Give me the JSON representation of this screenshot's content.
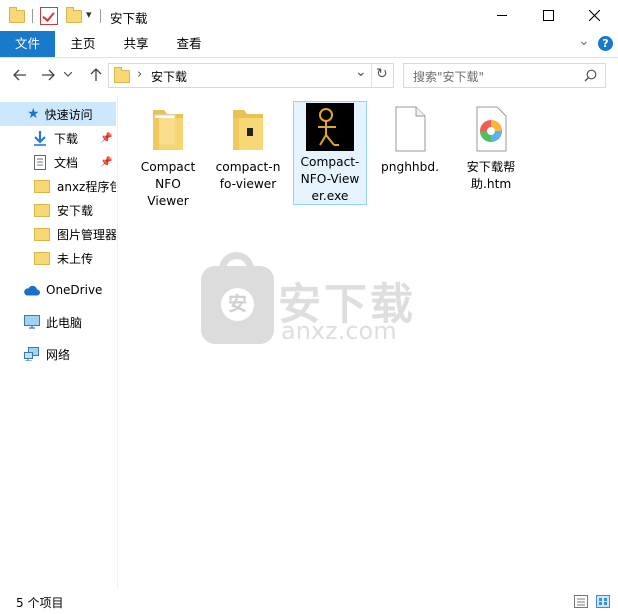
{
  "window": {
    "title": "安下载"
  },
  "quick_access_toolbar": {
    "dropdown_glyph": "▾"
  },
  "window_controls": {
    "minimize": "—",
    "maximize": "☐",
    "close": "✕"
  },
  "ribbon": {
    "tabs": [
      "文件",
      "主页",
      "共享",
      "查看"
    ],
    "expand_glyph": "⌄",
    "help_glyph": "?"
  },
  "address_bar": {
    "path_separator": "›",
    "location": "安下载",
    "dropdown": "⌄",
    "refresh": "↻"
  },
  "search": {
    "placeholder": "搜索\"安下载\""
  },
  "sidebar": {
    "quick_access_label": "快速访问",
    "items": [
      {
        "label": "下载",
        "icon": "download-arrow-icon",
        "pinned": true
      },
      {
        "label": "文档",
        "icon": "document-icon",
        "pinned": true
      },
      {
        "label": "anxz程序包",
        "icon": "folder-icon",
        "pinned": false
      },
      {
        "label": "安下载",
        "icon": "folder-icon",
        "pinned": false
      },
      {
        "label": "图片管理器",
        "icon": "folder-icon",
        "pinned": false
      },
      {
        "label": "未上传",
        "icon": "folder-icon",
        "pinned": false
      }
    ],
    "onedrive": "OneDrive",
    "this_pc": "此电脑",
    "network": "网络"
  },
  "files": [
    {
      "name_lines": [
        "Compact",
        "NFO",
        "Viewer"
      ],
      "type": "folder"
    },
    {
      "name_lines": [
        "compact-n",
        "fo-viewer"
      ],
      "type": "folder"
    },
    {
      "name_lines": [
        "Compact-",
        "NFO-View",
        "er.exe"
      ],
      "type": "exe"
    },
    {
      "name_lines": [
        "pnghhbd."
      ],
      "type": "file"
    },
    {
      "name_lines": [
        "安下载帮",
        "助.htm"
      ],
      "type": "htm"
    }
  ],
  "watermark": {
    "text": "安下载",
    "subtext": "anxz.com",
    "badge_char": "安"
  },
  "status": {
    "count_text": "5 个项目"
  },
  "colors": {
    "accent": "#1979ca",
    "selection": "#cce8ff",
    "folder": "#f8d775"
  }
}
